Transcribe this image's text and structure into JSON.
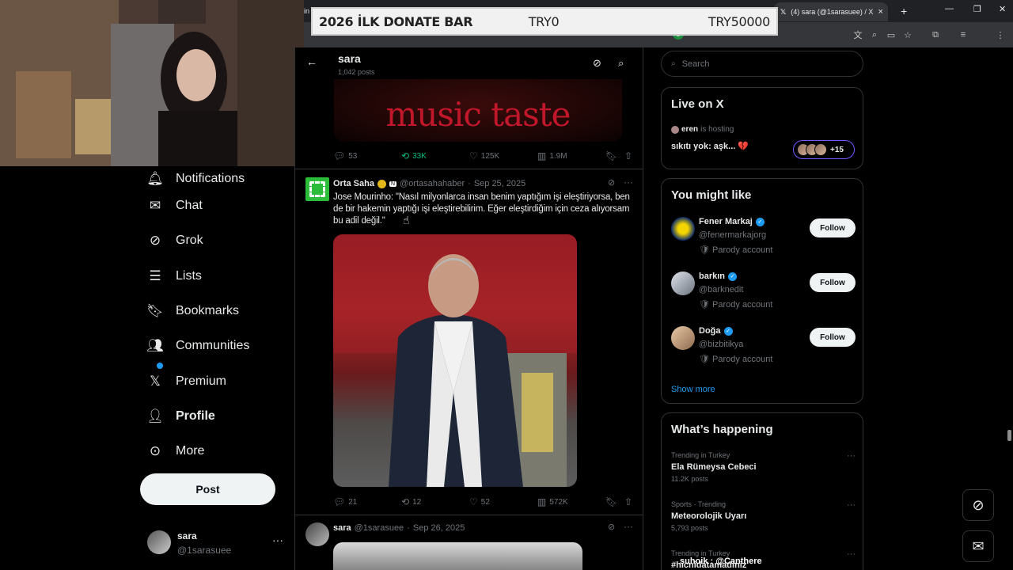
{
  "browser": {
    "tab_title": "(4) sara (@1sarasuee) / X",
    "tab_fragment": "in",
    "new_tab_glyph": "+",
    "profile_initial": "s"
  },
  "donate_bar": {
    "title": "2026 İLK DONATE BAR",
    "current": "TRY0",
    "goal": "TRY50000"
  },
  "nav": {
    "items": [
      {
        "label": "Notifications",
        "icon": "bell-icon"
      },
      {
        "label": "Chat",
        "icon": "envelope-icon"
      },
      {
        "label": "Grok",
        "icon": "grok-icon"
      },
      {
        "label": "Lists",
        "icon": "list-icon"
      },
      {
        "label": "Bookmarks",
        "icon": "bookmark-icon"
      },
      {
        "label": "Communities",
        "icon": "people-icon"
      },
      {
        "label": "Premium",
        "icon": "x-logo-icon"
      },
      {
        "label": "Profile",
        "icon": "person-icon"
      },
      {
        "label": "More",
        "icon": "more-circle-icon"
      }
    ],
    "post_label": "Post",
    "account": {
      "name": "sara",
      "handle": "@1sarasuee"
    }
  },
  "header": {
    "title": "sara",
    "subtitle": "1,042 posts"
  },
  "prev_tweet": {
    "media_text": "music taste",
    "stats": {
      "replies": "53",
      "reposts": "33K",
      "likes": "125K",
      "views": "1.9M"
    }
  },
  "tweet": {
    "name": "Orta Saha",
    "handle": "@ortasahahaber",
    "date": "Sep 25, 2025",
    "badge_n": "N",
    "text": "Jose Mourinho: \"Nasıl milyonlarca insan benim yaptığım işi eleştiriyorsa, ben de bir hakemin yaptığı işi eleştirebilirim. Eğer eleştirdiğim için ceza alıyorsam bu adil değil.\"",
    "stats": {
      "replies": "21",
      "reposts": "12",
      "likes": "52",
      "views": "572K"
    }
  },
  "tweet2": {
    "name": "sara",
    "handle": "@1sarasuee",
    "date": "Sep 26, 2025"
  },
  "right": {
    "search_placeholder": "Search",
    "live": {
      "title": "Live on X",
      "host": "eren",
      "host_suffix": "is hosting",
      "space_title": "sıkıtı yok: aşk... 💔",
      "count": "+15"
    },
    "you_might_like": {
      "title": "You might like",
      "follow_label": "Follow",
      "show_more": "Show more",
      "suggestions": [
        {
          "name": "Fener Markaj",
          "handle": "@fenermarkajorg",
          "note": "Parody account"
        },
        {
          "name": "barkın",
          "handle": "@barknedit",
          "note": "Parody account"
        },
        {
          "name": "Doğa",
          "handle": "@bizbitikya",
          "note": "Parody account"
        }
      ]
    },
    "whats_happening": {
      "title": "What’s happening",
      "trends": [
        {
          "context": "Trending in Turkey",
          "name": "Ela Rümeysa Cebeci",
          "posts": "11.2K posts"
        },
        {
          "context": "Sports · Trending",
          "name": "Meteorolojik Uyarı",
          "posts": "5,793 posts"
        },
        {
          "context": "Trending in Turkey",
          "name": "#hicnidatamadiniz",
          "posts": ""
        }
      ]
    },
    "ticker": "suhoik : @Canthere"
  },
  "colors": {
    "accent": "#1d9bf0",
    "repost_green": "#00ba7c",
    "live_purple": "#7856ff"
  }
}
